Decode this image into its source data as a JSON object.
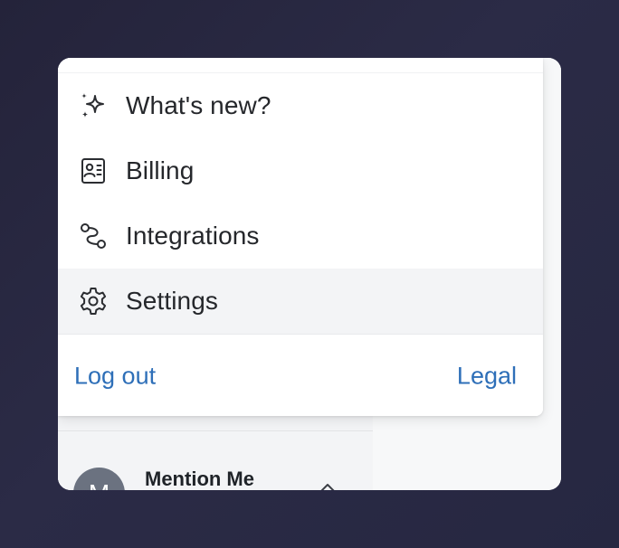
{
  "menu": {
    "items": [
      {
        "label": "What's new?",
        "icon": "sparkles-icon",
        "active": false
      },
      {
        "label": "Billing",
        "icon": "billing-icon",
        "active": false
      },
      {
        "label": "Integrations",
        "icon": "integrations-icon",
        "active": false
      },
      {
        "label": "Settings",
        "icon": "gear-icon",
        "active": true
      }
    ],
    "footer": {
      "logout_label": "Log out",
      "legal_label": "Legal"
    }
  },
  "account": {
    "avatar_initial": "M",
    "name": "Mention Me",
    "chevron_icon": "chevron-up-icon"
  },
  "colors": {
    "background": "#26263f",
    "link": "#2e6fb8",
    "active_item": "#f3f4f6",
    "text": "#25272b"
  }
}
